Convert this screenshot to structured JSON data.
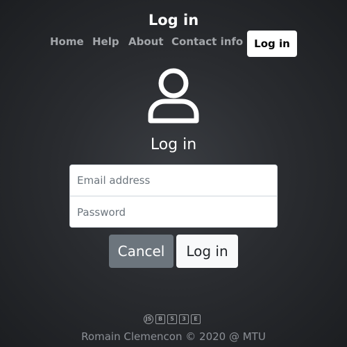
{
  "header": {
    "title": "Log in"
  },
  "nav": {
    "home": "Home",
    "help": "Help",
    "about": "About",
    "contact": "Contact info",
    "login": "Log in"
  },
  "main": {
    "icon": "user-icon",
    "heading": "Log in",
    "email_placeholder": "Email address",
    "password_placeholder": "Password",
    "cancel_label": "Cancel",
    "login_label": "Log in"
  },
  "footer": {
    "icons": [
      "nodejs-icon",
      "bootstrap-icon",
      "html5-icon",
      "css3-icon",
      "express-icon"
    ],
    "icon_glyphs": [
      "JS",
      "B",
      "5",
      "3",
      "E"
    ],
    "text": "Romain Clemencon © 2020 @ MTU"
  },
  "colors": {
    "background": "#2a2c30",
    "nav_link": "#a3a6aa",
    "cancel_button": "#6c757d",
    "login_button": "#f8f9fa",
    "footer_text": "#8c9096"
  }
}
